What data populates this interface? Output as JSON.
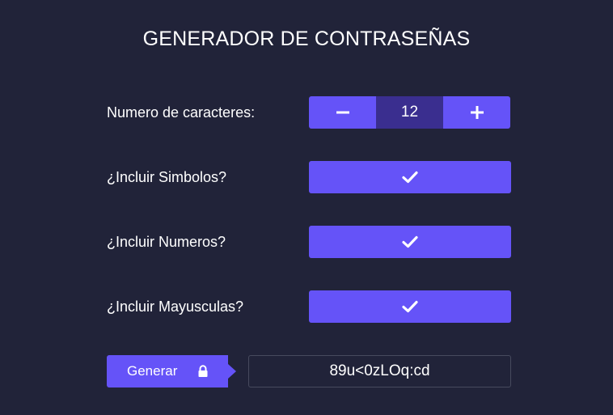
{
  "app": {
    "title": "GENERADOR DE CONTRASEÑAS"
  },
  "options": {
    "length_label": "Numero de caracteres:",
    "length_value": "12",
    "symbols_label": "¿Incluir Simbolos?",
    "symbols_checked": true,
    "numbers_label": "¿Incluir Numeros?",
    "numbers_checked": true,
    "uppercase_label": "¿Incluir Mayusculas?",
    "uppercase_checked": true
  },
  "actions": {
    "generate_label": "Generar",
    "generate_icon": "lock-icon"
  },
  "output": {
    "password": "89u<0zLOq:cd"
  },
  "colors": {
    "background": "#212339",
    "accent": "#6553f8",
    "accent_dark": "#3a2e8f",
    "output_border": "#474a5e"
  }
}
